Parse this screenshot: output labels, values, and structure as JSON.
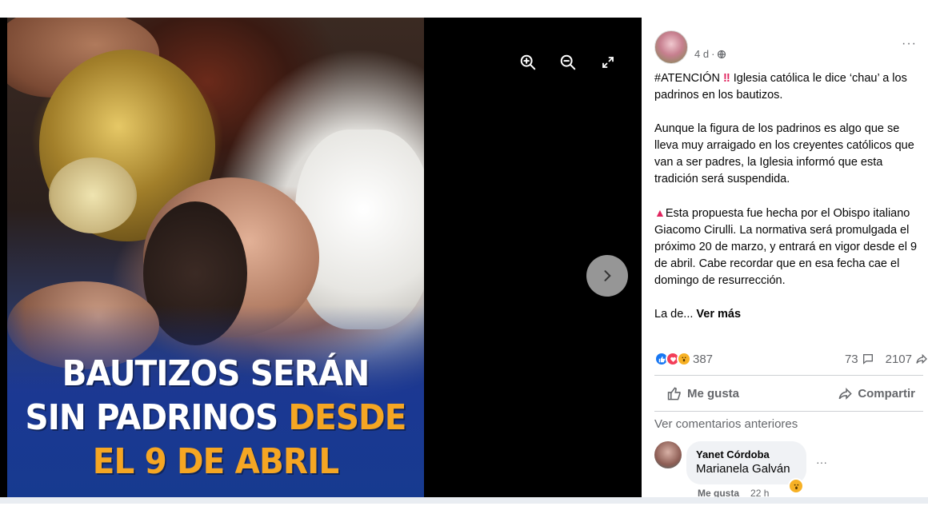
{
  "viewer": {
    "headline_line1": "BAUTIZOS SERÁN",
    "headline_line2_white": "SIN PADRINOS ",
    "headline_line2_orange": "DESDE",
    "headline_line3": "EL 9 DE ABRIL",
    "icons": [
      "zoom-in-icon",
      "zoom-out-icon",
      "fullscreen-icon",
      "chevron-right-icon"
    ]
  },
  "post": {
    "time": "4 d",
    "dot": "·",
    "p1_tag": "#ATENCIÓN",
    "p1_bang": "‼",
    "p1_text": " Iglesia católica le dice ‘chau’ a los padrinos en los bautizos.",
    "p2": "Aunque la figura de los padrinos es algo que se lleva muy arraigado en los creyentes católicos que van a ser padres, la Iglesia informó que esta tradición será suspendida.",
    "p3_icon": "▲",
    "p3": "Esta propuesta fue hecha por el Obispo italiano Giacomo Cirulli. La normativa será promulgada el próximo 20 de marzo, y entrará en vigor desde el 9 de abril. Cabe recordar que en esa fecha cae el domingo de resurrección.",
    "p4_text": "La de... ",
    "p4_more": "Ver más",
    "more_label": "···"
  },
  "stats": {
    "reactions_count": "387",
    "comments_count": "73",
    "shares_count": "2107"
  },
  "actions": {
    "like": "Me gusta",
    "share": "Compartir"
  },
  "comments": {
    "prev_label": "Ver comentarios anteriores",
    "items": [
      {
        "author": "Yanet Córdoba",
        "mention": "Marianela Galván",
        "like_label": "Me gusta",
        "time": "22 h",
        "more": "···"
      }
    ]
  },
  "colors": {
    "accent_orange": "#f5a623",
    "like_blue": "#1877f2",
    "love_red": "#f33e58",
    "wow_yellow": "#f7b125"
  }
}
